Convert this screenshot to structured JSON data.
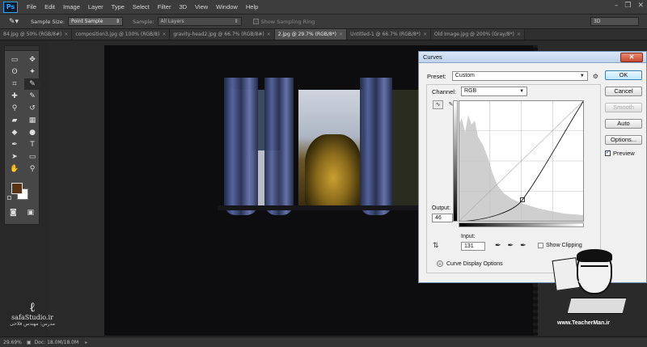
{
  "menubar": {
    "logo": "Ps",
    "items": [
      "File",
      "Edit",
      "Image",
      "Layer",
      "Type",
      "Select",
      "Filter",
      "3D",
      "View",
      "Window",
      "Help"
    ]
  },
  "options": {
    "sample_size_label": "Sample Size:",
    "sample_size_value": "Point Sample",
    "sample_label": "Sample:",
    "sample_value": "All Layers",
    "sampling_ring_label": "Show Sampling Ring",
    "workspace_value": "3D"
  },
  "tabs": [
    {
      "label": "84.jpg @ 50% (RGB/8#)",
      "active": false
    },
    {
      "label": "composition3.jpg @ 100% (RGB/8)",
      "active": false
    },
    {
      "label": "gravity-head2.jpg @ 66.7% (RGB/8#)",
      "active": false
    },
    {
      "label": "2.jpg @ 29.7% (RGB/8*)",
      "active": true
    },
    {
      "label": "Untitled-1 @ 66.7% (RGB/8*)",
      "active": false
    },
    {
      "label": "Old Image.jpg @ 200% (Gray/8*)",
      "active": false
    }
  ],
  "toolbox": {
    "tools": [
      "marquee-icon",
      "move-icon",
      "lasso-icon",
      "magic-wand-icon",
      "crop-icon",
      "eyedropper-icon",
      "healing-icon",
      "brush-icon",
      "stamp-icon",
      "history-brush-icon",
      "eraser-icon",
      "gradient-icon",
      "blur-icon",
      "dodge-icon",
      "pen-icon",
      "type-icon",
      "path-select-icon",
      "shape-icon",
      "hand-icon",
      "zoom-icon"
    ],
    "tool_glyphs": [
      "▭",
      "✥",
      "ʘ",
      "✦",
      "⌗",
      "✎",
      "✚",
      "✎",
      "⚲",
      "↺",
      "▰",
      "▦",
      "◆",
      "●",
      "✒",
      "T",
      "➤",
      "▭",
      "✋",
      "⚲"
    ],
    "foreground_color": "#5a3314",
    "background_color": "#ffffff"
  },
  "status": {
    "zoom": "29.69%",
    "doc": "Doc: 18.0M/18.0M"
  },
  "logo_left": {
    "name": "safaStudio.ir",
    "sub": "مدرس: مهندس فلاحی"
  },
  "curves": {
    "title": "Curves",
    "close_label": "✕",
    "preset_label": "Preset:",
    "preset_value": "Custom",
    "channel_label": "Channel:",
    "channel_value": "RGB",
    "output_label": "Output:",
    "output_value": "46",
    "input_label": "Input:",
    "input_value": "131",
    "show_clipping_label": "Show Clipping",
    "curve_display_options_label": "Curve Display Options",
    "buttons": {
      "ok": "OK",
      "cancel": "Cancel",
      "smooth": "Smooth",
      "auto": "Auto",
      "options": "Options..."
    },
    "preview_label": "Preview",
    "preview_checked": true
  },
  "teacher_badge": {
    "url": "www.TeacherMan.ir",
    "board_text": "TeacherMan"
  }
}
